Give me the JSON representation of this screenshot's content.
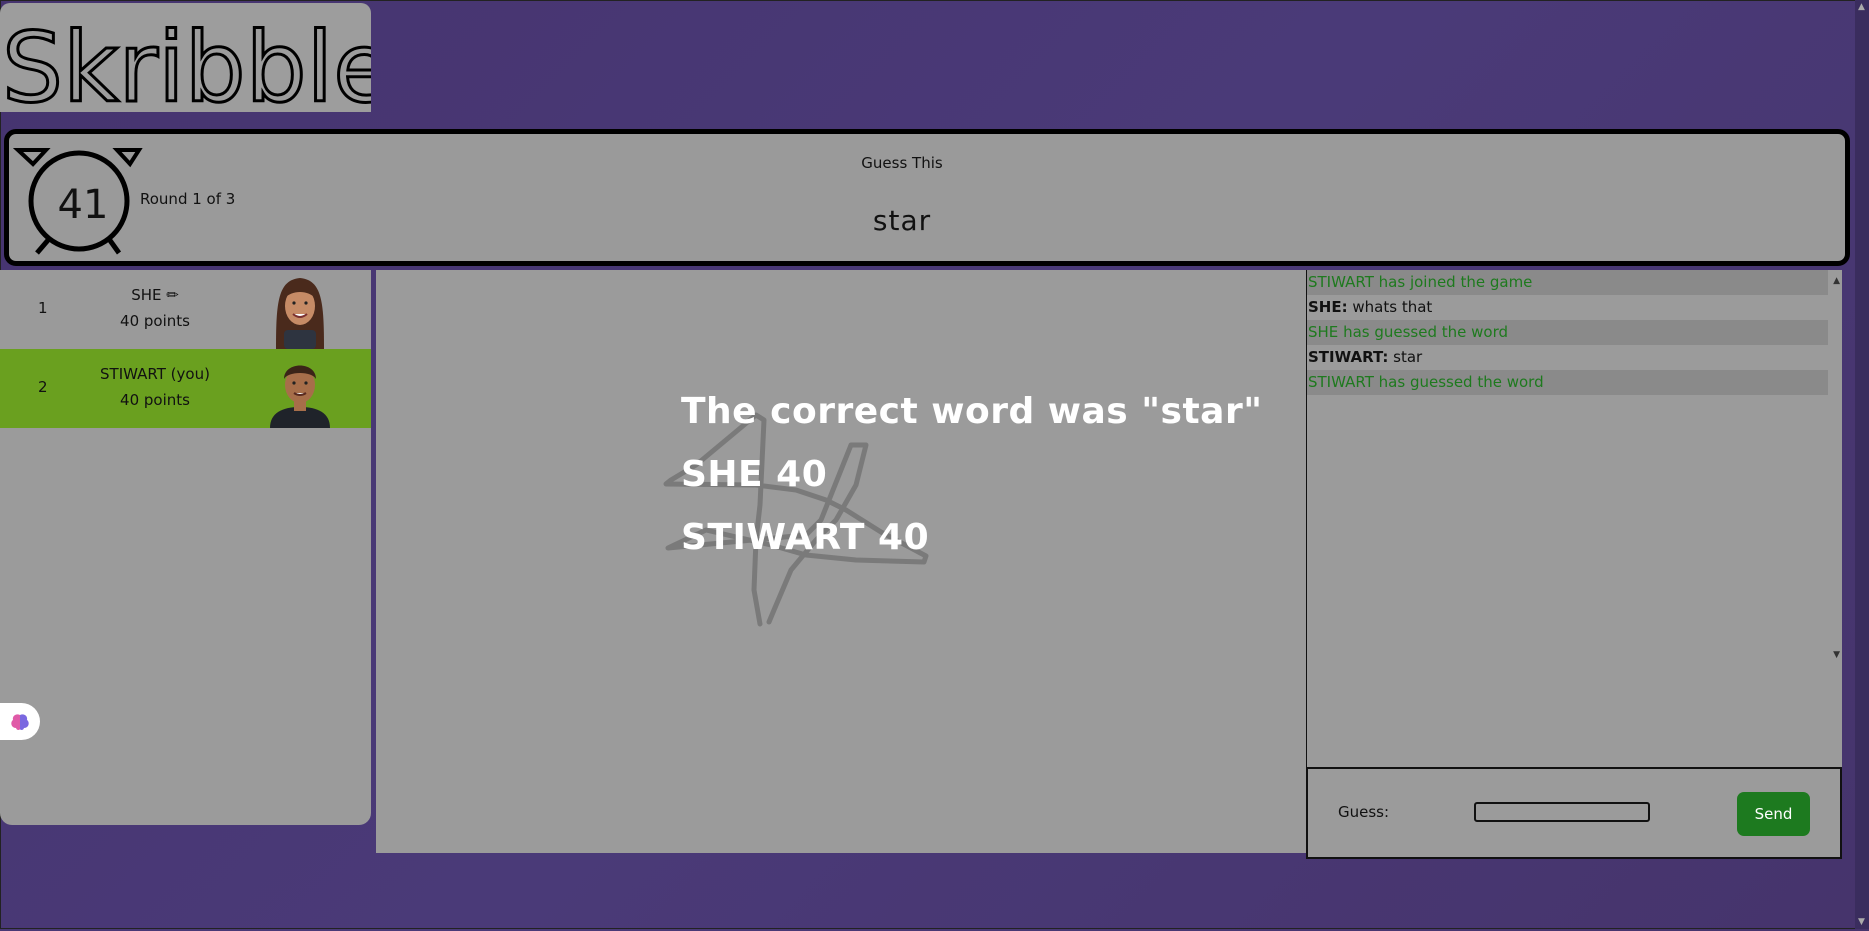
{
  "app": {
    "logo_text": "Skribble"
  },
  "header": {
    "timer": "41",
    "round": "Round 1 of 3",
    "guess_this": "Guess This",
    "word": "star"
  },
  "players": [
    {
      "rank": "1",
      "name": "SHE ✏",
      "points": "40 points",
      "avatar": "female-avatar"
    },
    {
      "rank": "2",
      "name": "STIWART (you)",
      "points": "40 points",
      "avatar": "male-avatar"
    }
  ],
  "overlay": {
    "line1": "The correct word was \"star\"",
    "line2": "SHE 40",
    "line3": "STIWART 40"
  },
  "chat": [
    {
      "name": "STIWART",
      "text": "has joined the game"
    },
    {
      "name": "SHE:",
      "text": "whats that"
    },
    {
      "name": "SHE",
      "text": "has guessed the word"
    },
    {
      "name": "STIWART:",
      "text": "star"
    },
    {
      "name": "STIWART",
      "text": "has guessed the word"
    }
  ],
  "guess": {
    "label": "Guess:",
    "value": "",
    "send_label": "Send"
  },
  "colors": {
    "highlight_player": "#6aa01f",
    "send_button": "#1d7a1f",
    "system_message": "#1e7a1e"
  }
}
